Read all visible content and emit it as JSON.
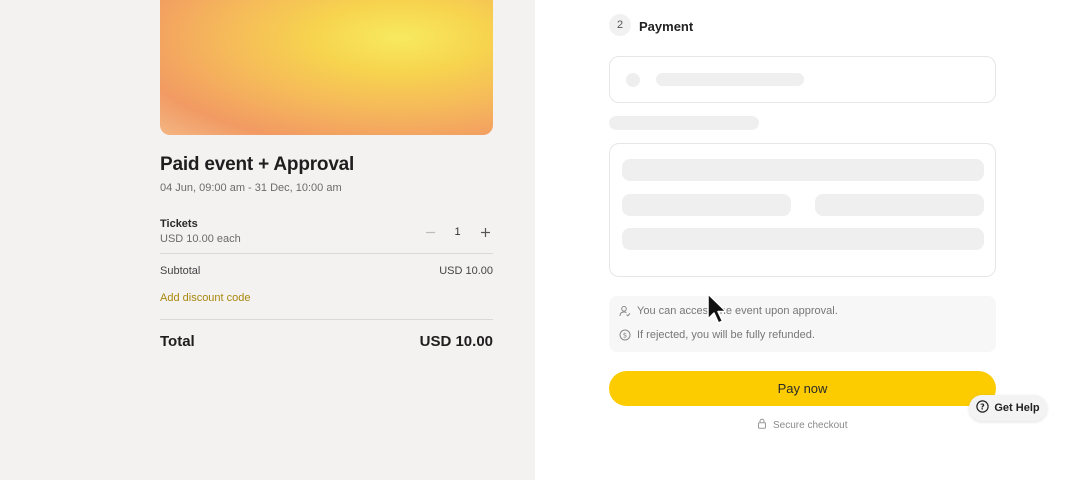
{
  "event": {
    "title": "Paid event + Approval",
    "date_range": "04 Jun, 09:00 am - 31 Dec, 10:00 am"
  },
  "tickets": {
    "label": "Tickets",
    "price_each": "USD 10.00 each",
    "quantity": "1",
    "minus_icon": "minus-icon",
    "plus_icon": "plus-icon"
  },
  "summary": {
    "subtotal_label": "Subtotal",
    "subtotal_value": "USD 10.00",
    "discount_link": "Add discount code",
    "total_label": "Total",
    "total_value": "USD 10.00"
  },
  "payment": {
    "step_number": "2",
    "step_title": "Payment"
  },
  "info": {
    "approval_text": "You can access the event upon approval.",
    "refund_text": "If rejected, you will be fully refunded.",
    "approval_icon": "user-check-icon",
    "refund_icon": "dollar-circle-icon"
  },
  "actions": {
    "pay_label": "Pay now",
    "secure_label": "Secure checkout",
    "secure_icon": "lock-icon",
    "help_label": "Get Help",
    "help_icon": "question-circle-icon"
  },
  "colors": {
    "accent": "#fccc00",
    "discount_link": "#a8880d",
    "left_panel_bg": "#f4f1f1"
  }
}
